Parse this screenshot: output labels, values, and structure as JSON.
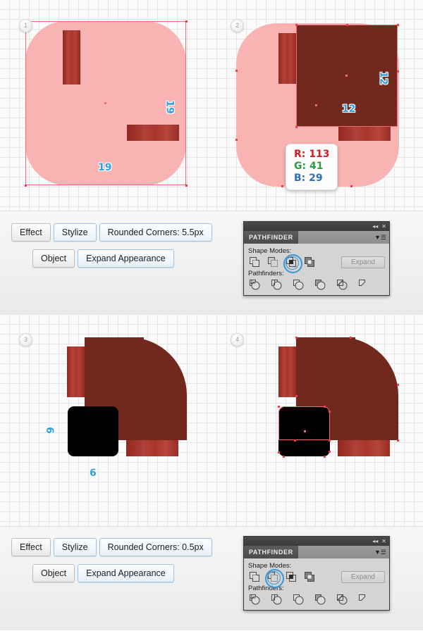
{
  "tutorial": {
    "title": "Illustrator shape-building tutorial steps",
    "steps": [
      {
        "badge": "1"
      },
      {
        "badge": "2"
      },
      {
        "badge": "3"
      },
      {
        "badge": "4"
      }
    ]
  },
  "step1": {
    "badge": "1",
    "dim_width": "19",
    "dim_height": "19"
  },
  "step2": {
    "badge": "2",
    "dim_width": "12",
    "dim_height": "12",
    "color_readout": {
      "r_label": "R: 113",
      "g_label": "G: 41",
      "b_label": "B: 29",
      "r_color": "#cc2027",
      "g_color": "#2f9b44",
      "b_color": "#2f6fb5"
    }
  },
  "step3": {
    "badge": "3",
    "dim_width": "6",
    "dim_height": "6"
  },
  "step4": {
    "badge": "4"
  },
  "toolbar_top": {
    "row1": [
      {
        "label": "Effect",
        "highlighted": false
      },
      {
        "label": "Stylize",
        "highlighted": true
      },
      {
        "label": "Rounded Corners: 5.5px",
        "highlighted": true
      }
    ],
    "row2": [
      {
        "label": "Object",
        "highlighted": false
      },
      {
        "label": "Expand Appearance",
        "highlighted": true
      }
    ]
  },
  "toolbar_bottom": {
    "row1": [
      {
        "label": "Effect",
        "highlighted": false
      },
      {
        "label": "Stylize",
        "highlighted": true
      },
      {
        "label": "Rounded Corners: 0.5px",
        "highlighted": true
      }
    ],
    "row2": [
      {
        "label": "Object",
        "highlighted": false
      },
      {
        "label": "Expand Appearance",
        "highlighted": true
      }
    ]
  },
  "pathfinder_top": {
    "tab_title": "PATHFINDER",
    "collapse_icon": "collapse-to-icons-icon",
    "close_icon": "close-icon",
    "menu_icon": "panel-menu-icon",
    "shape_modes_label": "Shape Modes:",
    "pathfinders_label": "Pathfinders:",
    "expand_label": "Expand",
    "shape_modes": [
      {
        "name": "unite-icon",
        "active": false
      },
      {
        "name": "minus-front-icon",
        "active": false
      },
      {
        "name": "intersect-icon",
        "active": true
      },
      {
        "name": "exclude-icon",
        "active": false
      }
    ],
    "pathfinders": [
      {
        "name": "divide-icon"
      },
      {
        "name": "trim-icon"
      },
      {
        "name": "merge-icon"
      },
      {
        "name": "crop-icon"
      },
      {
        "name": "outline-icon"
      },
      {
        "name": "minus-back-icon"
      }
    ],
    "accent_color": "#3b97d6"
  },
  "pathfinder_bottom": {
    "tab_title": "PATHFINDER",
    "collapse_icon": "collapse-to-icons-icon",
    "close_icon": "close-icon",
    "menu_icon": "panel-menu-icon",
    "shape_modes_label": "Shape Modes:",
    "pathfinders_label": "Pathfinders:",
    "expand_label": "Expand",
    "shape_modes": [
      {
        "name": "unite-icon",
        "active": false
      },
      {
        "name": "minus-front-icon",
        "active": true
      },
      {
        "name": "intersect-icon",
        "active": false
      },
      {
        "name": "exclude-icon",
        "active": false
      }
    ],
    "pathfinders": [
      {
        "name": "divide-icon"
      },
      {
        "name": "trim-icon"
      },
      {
        "name": "merge-icon"
      },
      {
        "name": "crop-icon"
      },
      {
        "name": "outline-icon"
      },
      {
        "name": "minus-back-icon"
      }
    ],
    "accent_color": "#3b97d6"
  },
  "colors": {
    "pink_shape": "#f9b3b3",
    "dark_red": "#71291d",
    "bar_red": "#a8362d",
    "black_square": "#000000",
    "selection_red": "#f06b72",
    "dimension_blue": "#2f9fe0"
  }
}
